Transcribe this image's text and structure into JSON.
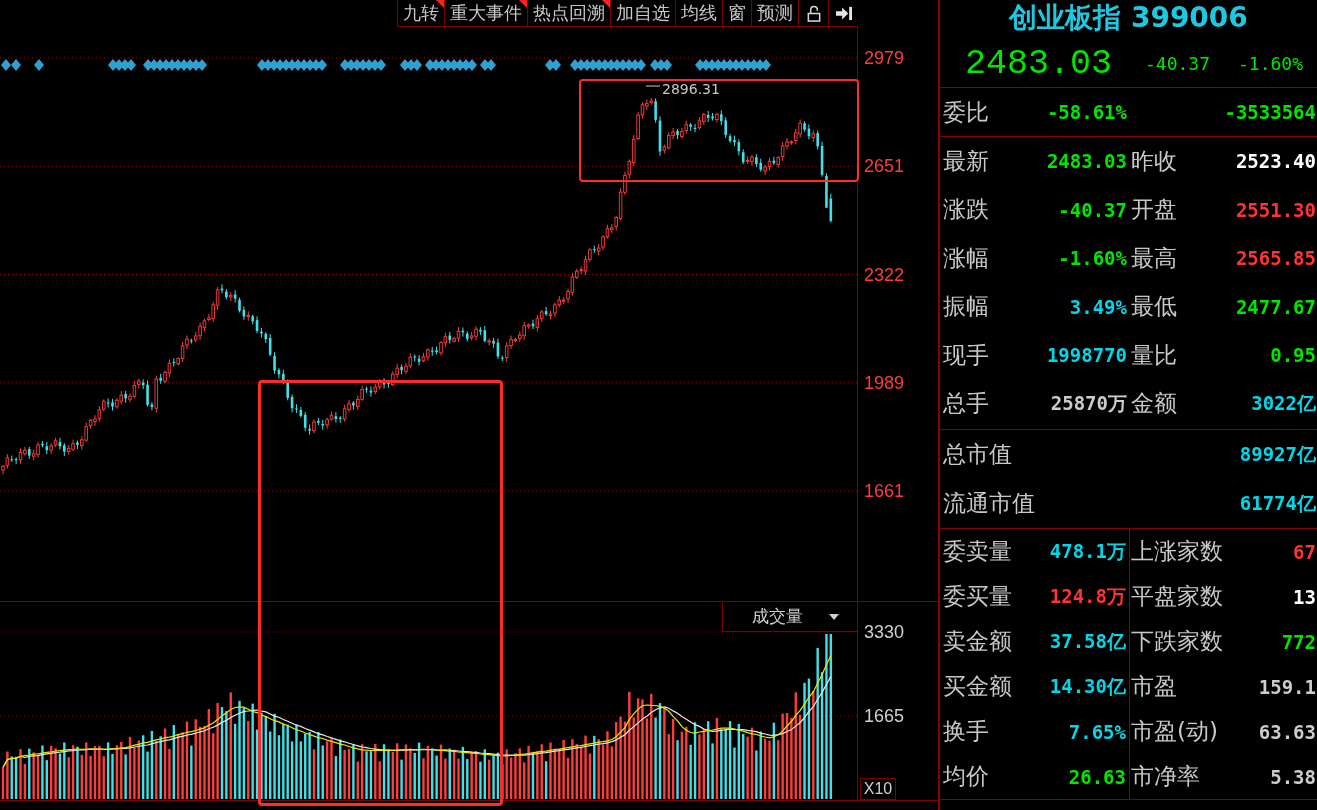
{
  "toolbar": {
    "buttons": [
      {
        "label": "九转",
        "flagged": true
      },
      {
        "label": "重大事件",
        "flagged": true
      },
      {
        "label": "热点回溯",
        "flagged": true
      },
      {
        "label": "加自选",
        "flagged": false
      },
      {
        "label": "均线",
        "flagged": false
      },
      {
        "label": "窗",
        "flagged": false
      },
      {
        "label": "预测",
        "flagged": false
      }
    ]
  },
  "price_chart": {
    "axis_labels": [
      "2979",
      "2651",
      "2322",
      "1989",
      "1661"
    ],
    "peak_label": "2896.31"
  },
  "volume_chart": {
    "indicator": "成交量",
    "axis_labels": [
      "3330",
      "1665"
    ],
    "scale": "X10"
  },
  "quote": {
    "title": "创业板指 399006",
    "price": {
      "text": "2483.03",
      "color": "#00e600"
    },
    "change": {
      "text": "-40.37",
      "color": "#00e600"
    },
    "change_percent": {
      "text": "-1.60%",
      "color": "#00e600"
    },
    "bid_ratio": {
      "label": "委比",
      "ratio": {
        "text": "-58.61%",
        "color": "#00e600"
      },
      "difference": {
        "text": "-3533564",
        "color": "#00e600"
      }
    },
    "stats": [
      {
        "label": "最新",
        "value": "2483.03",
        "color": "#00e600"
      },
      {
        "label": "昨收",
        "value": "2523.40",
        "color": "#ffffff"
      },
      {
        "label": "涨跌",
        "value": "-40.37",
        "color": "#00e600"
      },
      {
        "label": "开盘",
        "value": "2551.30",
        "color": "#ff3333"
      },
      {
        "label": "涨幅",
        "value": "-1.60%",
        "color": "#00e600"
      },
      {
        "label": "最高",
        "value": "2565.85",
        "color": "#ff3333"
      },
      {
        "label": "振幅",
        "value": "3.49%",
        "color": "#00d7e9"
      },
      {
        "label": "最低",
        "value": "2477.67",
        "color": "#00e600"
      },
      {
        "label": "现手",
        "value": "1998770",
        "color": "#00d7e9"
      },
      {
        "label": "量比",
        "value": "0.95",
        "color": "#00e600"
      },
      {
        "label": "总手",
        "value": "25870万",
        "color": "#cccccc"
      },
      {
        "label": "金额",
        "value": "3022亿",
        "color": "#00d7e9"
      }
    ],
    "market_value": [
      {
        "label": "总市值",
        "value": "89927亿",
        "color": "#00d7e9"
      },
      {
        "label": "流通市值",
        "value": "61774亿",
        "color": "#00d7e9"
      }
    ],
    "order_stats": [
      {
        "label": "委卖量",
        "value": "478.1万",
        "color": "#00d7e9"
      },
      {
        "label": "上涨家数",
        "value": "67",
        "color": "#ff3333"
      },
      {
        "label": "委买量",
        "value": "124.8万",
        "color": "#ff3333"
      },
      {
        "label": "平盘家数",
        "value": "13",
        "color": "#ffffff"
      },
      {
        "label": "卖金额",
        "value": "37.58亿",
        "color": "#00d7e9"
      },
      {
        "label": "下跌家数",
        "value": "772",
        "color": "#00e600"
      },
      {
        "label": "买金额",
        "value": "14.30亿",
        "color": "#00d7e9"
      },
      {
        "label": "市盈",
        "value": "159.1",
        "color": "#cccccc"
      },
      {
        "label": "换手",
        "value": "7.65%",
        "color": "#00d7e9"
      },
      {
        "label": "市盈(动)",
        "value": "63.63",
        "color": "#cccccc"
      },
      {
        "label": "均价",
        "value": "26.63",
        "color": "#00e600"
      },
      {
        "label": "市净率",
        "value": "5.38",
        "color": "#cccccc"
      }
    ]
  }
}
